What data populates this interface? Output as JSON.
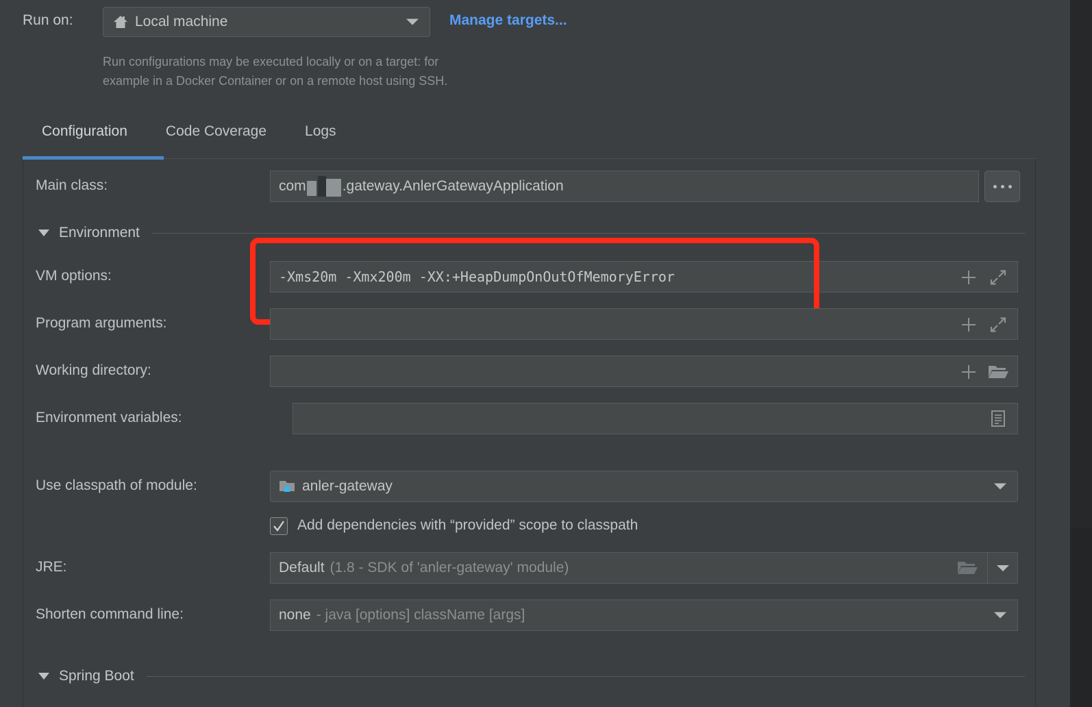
{
  "run_on": {
    "label": "Run on:",
    "selected": "Local machine",
    "icon": "home-icon",
    "manage_link": "Manage targets...",
    "hint_line1": "Run configurations may be executed locally or on a target: for",
    "hint_line2": "example in a Docker Container or on a remote host using SSH."
  },
  "tabs": [
    {
      "label": "Configuration",
      "active": true
    },
    {
      "label": "Code Coverage",
      "active": false
    },
    {
      "label": "Logs",
      "active": false
    }
  ],
  "form": {
    "main_class": {
      "label": "Main class:",
      "value_prefix": "com",
      "value_suffix": ".gateway.AnlerGatewayApplication",
      "browse_button": "..."
    },
    "environment_section": "Environment",
    "vm_options": {
      "label": "VM options:",
      "value": "-Xms20m  -Xmx200m  -XX:+HeapDumpOnOutOfMemoryError"
    },
    "program_arguments": {
      "label": "Program arguments:",
      "value": ""
    },
    "working_directory": {
      "label": "Working directory:",
      "value": ""
    },
    "environment_variables": {
      "label": "Environment variables:",
      "value": ""
    },
    "classpath_module": {
      "label": "Use classpath of module:",
      "value": "anler-gateway"
    },
    "add_dependencies": {
      "label": "Add dependencies with “provided” scope to classpath",
      "checked": true
    },
    "jre": {
      "label": "JRE:",
      "value_strong": "Default",
      "value_dim": "(1.8 - SDK of 'anler-gateway' module)"
    },
    "shorten_command_line": {
      "label": "Shorten command line:",
      "value_strong": "none",
      "value_dim": "- java [options] className [args]"
    },
    "spring_boot_section": "Spring Boot"
  },
  "icons": {
    "plus": "plus-icon",
    "expand": "expand-icon",
    "folder": "folder-icon",
    "document": "document-icon",
    "dropdown": "chevron-down-icon"
  },
  "colors": {
    "background": "#3c3f41",
    "field": "#45494a",
    "accent_link": "#589df6",
    "tab_underline": "#4a88c7",
    "highlight_box": "#ff2a18",
    "text": "#c3c3c3",
    "text_dim": "#8b8f90"
  }
}
